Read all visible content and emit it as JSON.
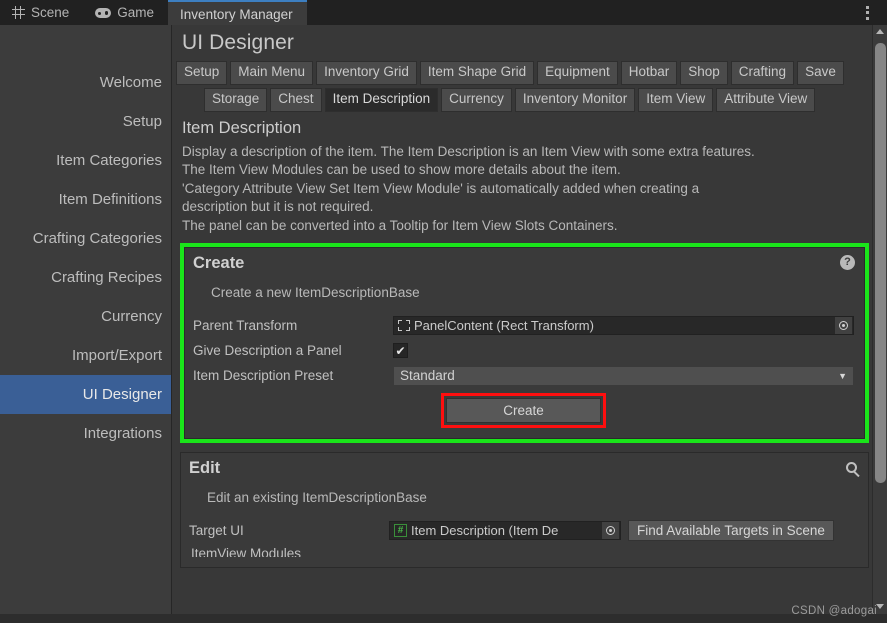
{
  "window_tabs": [
    {
      "label": "Scene",
      "icon": "grid-icon",
      "active": false
    },
    {
      "label": "Game",
      "icon": "gamepad-icon",
      "active": false
    },
    {
      "label": "Inventory Manager",
      "icon": "none",
      "active": true
    }
  ],
  "window_menu_icon": "kebab-menu-icon",
  "sidebar": {
    "items": [
      {
        "label": "Welcome",
        "selected": false
      },
      {
        "label": "Setup",
        "selected": false
      },
      {
        "label": "Item Categories",
        "selected": false
      },
      {
        "label": "Item Definitions",
        "selected": false
      },
      {
        "label": "Crafting Categories",
        "selected": false
      },
      {
        "label": "Crafting Recipes",
        "selected": false
      },
      {
        "label": "Currency",
        "selected": false
      },
      {
        "label": "Import/Export",
        "selected": false
      },
      {
        "label": "UI Designer",
        "selected": true
      },
      {
        "label": "Integrations",
        "selected": false
      }
    ]
  },
  "page": {
    "title": "UI Designer",
    "tabs_row1": [
      {
        "label": "Setup",
        "selected": false
      },
      {
        "label": "Main Menu",
        "selected": false
      },
      {
        "label": "Inventory Grid",
        "selected": false
      },
      {
        "label": "Item Shape Grid",
        "selected": false
      },
      {
        "label": "Equipment",
        "selected": false
      },
      {
        "label": "Hotbar",
        "selected": false
      },
      {
        "label": "Shop",
        "selected": false
      },
      {
        "label": "Crafting",
        "selected": false
      },
      {
        "label": "Save",
        "selected": false
      }
    ],
    "tabs_row2": [
      {
        "label": "Storage",
        "selected": false
      },
      {
        "label": "Chest",
        "selected": false
      },
      {
        "label": "Item Description",
        "selected": true
      },
      {
        "label": "Currency",
        "selected": false
      },
      {
        "label": "Inventory Monitor",
        "selected": false
      },
      {
        "label": "Item View",
        "selected": false
      },
      {
        "label": "Attribute View",
        "selected": false
      }
    ]
  },
  "description": {
    "heading": "Item Description",
    "body": "Display a description of the item. The Item Description is an Item View with some extra features.\nThe Item View Modules can be used to show more details about the item.\n'Category Attribute View Set Item View Module' is automatically added when creating a\ndescription but it is not required.\nThe panel can be converted into a Tooltip for Item View Slots Containers."
  },
  "create_panel": {
    "heading": "Create",
    "help_icon": "question-mark-icon",
    "subtitle": "Create a new ItemDescriptionBase",
    "parent_transform_label": "Parent Transform",
    "parent_transform_value": "PanelContent (Rect Transform)",
    "parent_transform_icon": "rect-transform-icon",
    "picker_icon": "object-picker-icon",
    "give_panel_label": "Give Description a Panel",
    "give_panel_checked": "✔",
    "preset_label": "Item Description Preset",
    "preset_value": "Standard",
    "preset_caret": "▼",
    "create_button": "Create",
    "highlight_color": "#1ae51a",
    "button_highlight_color": "#ff0f0f"
  },
  "edit_panel": {
    "heading": "Edit",
    "search_icon": "magnifier-icon",
    "subtitle": "Edit an existing ItemDescriptionBase",
    "target_label": "Target UI",
    "target_value": "Item Description (Item De",
    "target_icon": "script-icon",
    "picker_icon": "object-picker-icon",
    "find_button": "Find Available Targets in Scene",
    "cut_row_label": "ItemView Modules"
  },
  "scrollbar": {
    "up_arrow": "scroll-up-arrow",
    "down_arrow": "scroll-down-arrow"
  },
  "watermark": "CSDN @adogai"
}
